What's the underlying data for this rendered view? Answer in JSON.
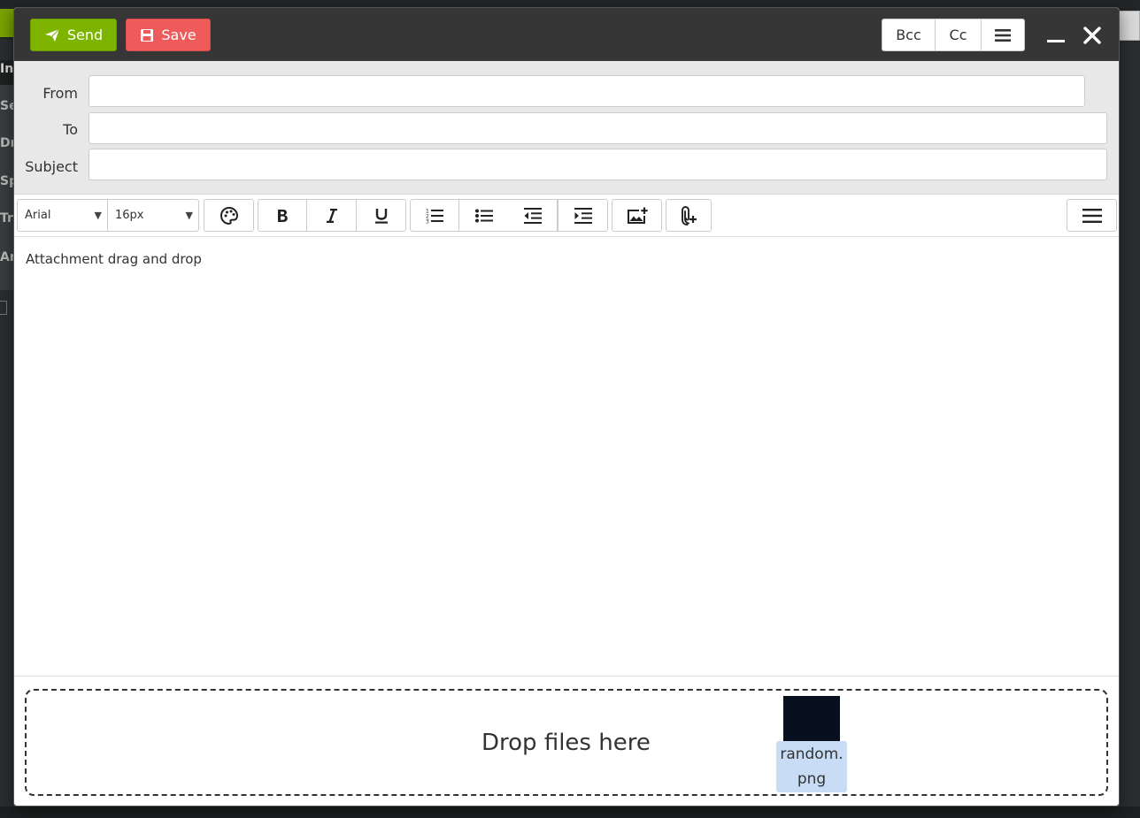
{
  "background": {
    "sidebar_labels": [
      "In",
      "Se",
      "Dr",
      "Sp",
      "Tr",
      "Ar"
    ]
  },
  "header": {
    "send_label": "Send",
    "save_label": "Save",
    "bcc_label": "Bcc",
    "cc_label": "Cc",
    "icons": {
      "send": "paper-plane-icon",
      "save": "floppy-disk-icon",
      "menu": "hamburger-icon",
      "minimize": "minimize-icon",
      "close": "close-icon"
    },
    "colors": {
      "send": "#7db400",
      "save": "#ef5b5b",
      "bar": "#363636"
    }
  },
  "fields": {
    "from_label": "From",
    "from_value": "",
    "to_label": "To",
    "to_value": "",
    "subject_label": "Subject",
    "subject_value": ""
  },
  "toolbar": {
    "font_family": "Arial",
    "font_size": "16px",
    "icons": [
      "palette-icon",
      "bold-icon",
      "italic-icon",
      "underline-icon",
      "ordered-list-icon",
      "unordered-list-icon",
      "outdent-icon",
      "indent-icon",
      "insert-image-icon",
      "attach-file-icon",
      "more-menu-icon"
    ]
  },
  "editor": {
    "body_text": "Attachment drag and drop"
  },
  "dropzone": {
    "label": "Drop files here",
    "dragged_file": "random.png"
  }
}
